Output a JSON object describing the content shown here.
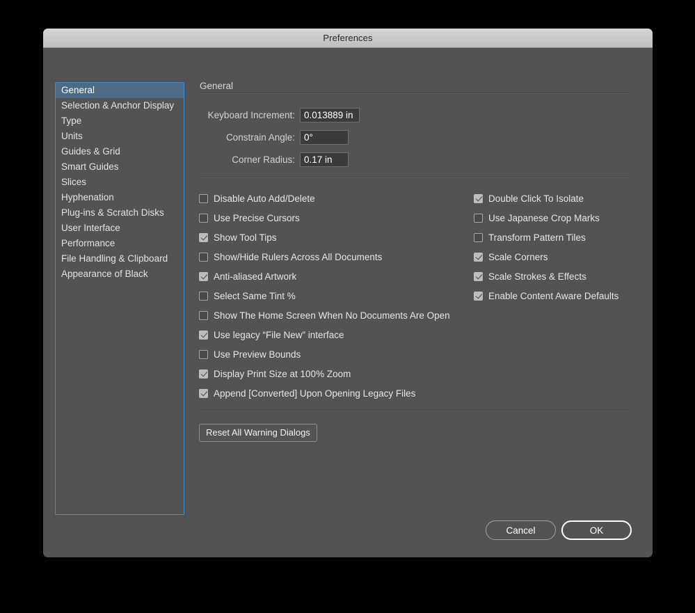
{
  "window": {
    "title": "Preferences"
  },
  "sidebar": {
    "items": [
      {
        "label": "General",
        "selected": true
      },
      {
        "label": "Selection & Anchor Display",
        "selected": false
      },
      {
        "label": "Type",
        "selected": false
      },
      {
        "label": "Units",
        "selected": false
      },
      {
        "label": "Guides & Grid",
        "selected": false
      },
      {
        "label": "Smart Guides",
        "selected": false
      },
      {
        "label": "Slices",
        "selected": false
      },
      {
        "label": "Hyphenation",
        "selected": false
      },
      {
        "label": "Plug-ins & Scratch Disks",
        "selected": false
      },
      {
        "label": "User Interface",
        "selected": false
      },
      {
        "label": "Performance",
        "selected": false
      },
      {
        "label": "File Handling & Clipboard",
        "selected": false
      },
      {
        "label": "Appearance of Black",
        "selected": false
      }
    ]
  },
  "pane": {
    "title": "General",
    "fields": [
      {
        "label": "Keyboard Increment:",
        "value": "0.013889 in"
      },
      {
        "label": "Constrain Angle:",
        "value": "0°"
      },
      {
        "label": "Corner Radius:",
        "value": "0.17 in"
      }
    ],
    "checkboxes_left": [
      {
        "label": "Disable Auto Add/Delete",
        "checked": false
      },
      {
        "label": "Use Precise Cursors",
        "checked": false
      },
      {
        "label": "Show Tool Tips",
        "checked": true
      },
      {
        "label": "Show/Hide Rulers Across All Documents",
        "checked": false
      },
      {
        "label": "Anti-aliased Artwork",
        "checked": true
      },
      {
        "label": "Select Same Tint %",
        "checked": false
      },
      {
        "label": "Show The Home Screen When No Documents Are Open",
        "checked": false
      },
      {
        "label": "Use legacy “File New” interface",
        "checked": true
      },
      {
        "label": "Use Preview Bounds",
        "checked": false
      },
      {
        "label": "Display Print Size at 100% Zoom",
        "checked": true
      },
      {
        "label": "Append [Converted] Upon Opening Legacy Files",
        "checked": true
      }
    ],
    "checkboxes_right": [
      {
        "label": "Double Click To Isolate",
        "checked": true
      },
      {
        "label": "Use Japanese Crop Marks",
        "checked": false
      },
      {
        "label": "Transform Pattern Tiles",
        "checked": false
      },
      {
        "label": "Scale Corners",
        "checked": true
      },
      {
        "label": "Scale Strokes & Effects",
        "checked": true
      },
      {
        "label": "Enable Content Aware Defaults",
        "checked": true
      }
    ],
    "reset_button": "Reset All Warning Dialogs"
  },
  "footer": {
    "cancel_label": "Cancel",
    "ok_label": "OK"
  },
  "colors": {
    "dialog_background": "#535353",
    "titlebar": "#c8c8c8",
    "selection": "#4e6b86",
    "focus_border": "#3e90d8",
    "text": "#e6e6e6"
  }
}
